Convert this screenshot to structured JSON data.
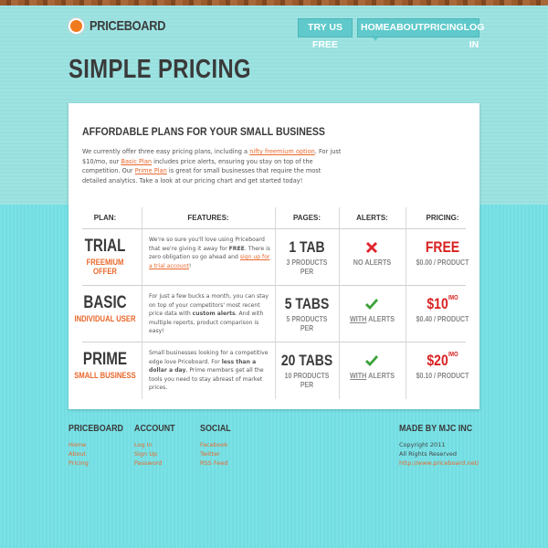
{
  "brand": {
    "name": "PRICEBOARD"
  },
  "nav": {
    "try": "TRY US FREE",
    "items": [
      "HOME",
      "ABOUT",
      "PRICING",
      "LOG IN"
    ]
  },
  "page_title": "SIMPLE PRICING",
  "card": {
    "heading": "AFFORDABLE PLANS FOR YOUR SMALL BUSINESS",
    "intro": {
      "p1": "We currently offer three easy pricing plans, including a ",
      "l1": "nifty freemium option",
      "p2": ". For just $10/mo, our ",
      "l2": "Basic Plan",
      "p3": " includes price alerts, ensuring you stay on top of the competition. Our ",
      "l3": "Prime Plan",
      "p4": " is great for small businesses that require the most detailed analytics. Take a look at our pricing chart and get started today!"
    }
  },
  "table": {
    "headers": [
      "PLAN:",
      "FEATURES:",
      "PAGES:",
      "ALERTS:",
      "PRICING:"
    ],
    "rows": [
      {
        "name": "TRIAL",
        "sub": "FREEMIUM OFFER",
        "f1": "We're so sure you'll love using Priceboard that we're giving it away for ",
        "f1b": "FREE",
        "f2": ". There is zero obligation so go ahead and ",
        "f2l": "sign up for a trial account",
        "f3": "!",
        "pages": "1 TAB",
        "pages_sub": "3 PRODUCTS PER",
        "alert_icon": "cross-icon",
        "alert_pre": "",
        "alert_text": "NO ALERTS",
        "price": "FREE",
        "price_small": "",
        "price_sub": "$0.00 / PRODUCT"
      },
      {
        "name": "BASIC",
        "sub": "INDIVIDUAL USER",
        "f1": "For just a few bucks a month, you can stay on top of your competitors' most recent price data with ",
        "f1b": "custom alerts",
        "f2": ". And with multiple reports, product comparison is easy!",
        "f2l": "",
        "f3": "",
        "pages": "5 TABS",
        "pages_sub": "5 PRODUCTS PER",
        "alert_icon": "check-icon",
        "alert_pre": "WITH",
        "alert_text": " ALERTS",
        "price": "$10",
        "price_small": "/MO",
        "price_sub": "$0.40 / PRODUCT"
      },
      {
        "name": "PRIME",
        "sub": "SMALL BUSINESS",
        "f1": "Small businesses looking for a competitive edge love Priceboard. For ",
        "f1b": "less than a dollar a day",
        "f2": ", Prime members get all the tools you need to stay abreast of market prices.",
        "f2l": "",
        "f3": "",
        "pages": "20 TABS",
        "pages_sub": "10 PRODUCTS PER",
        "alert_icon": "check-icon",
        "alert_pre": "WITH",
        "alert_text": " ALERTS",
        "price": "$20",
        "price_small": "/MO",
        "price_sub": "$0.10 / PRODUCT"
      }
    ]
  },
  "footer": {
    "priceboard": {
      "title": "PRICEBOARD",
      "links": [
        "Home",
        "About",
        "Pricing"
      ]
    },
    "account": {
      "title": "ACCOUNT",
      "links": [
        "Log In",
        "Sign Up",
        "Password"
      ]
    },
    "social": {
      "title": "SOCIAL",
      "links": [
        "Facebook",
        "Twitter",
        "RSS Feed"
      ]
    },
    "made": {
      "title": "MADE BY MJC INC",
      "line1": "Copyright 2011",
      "line2": "All Rights Reserved",
      "link": "http://www.priceboard.net/"
    }
  },
  "colors": {
    "accent": "#e8672b",
    "price": "#d92020",
    "nav": "#5fc9cb",
    "bg": "#7fe0e4"
  }
}
